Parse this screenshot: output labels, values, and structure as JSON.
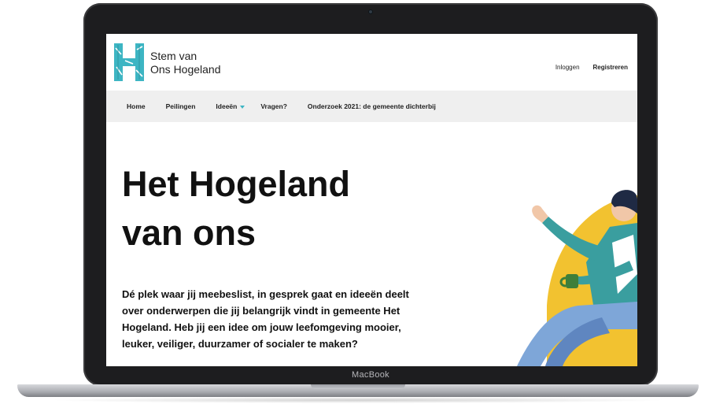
{
  "device": {
    "brand_label": "MacBook"
  },
  "site": {
    "logo": {
      "line1": "Stem van",
      "line2": "Ons Hogeland"
    },
    "auth": {
      "login": "Inloggen",
      "register": "Registreren"
    },
    "nav": [
      {
        "label": "Home"
      },
      {
        "label": "Peilingen"
      },
      {
        "label": "Ideeën"
      },
      {
        "label": "Vragen?"
      },
      {
        "label": "Onderzoek 2021: de gemeente dichterbij"
      }
    ],
    "hero": {
      "title_line1": "Het Hogeland",
      "title_line2": "van ons",
      "intro": "Dé plek waar jij meebeslist, in gesprek gaat en ideeën deelt over onderwerpen die jij belangrijk vindt in gemeente Het Hogeland. Heb jij een idee om jouw leefomgeving mooier, leuker, veiliger, duurzamer of socialer te maken?"
    }
  },
  "colors": {
    "brand_teal": "#3db5c3",
    "nav_bg": "#efefef",
    "accent_yellow": "#f2c230",
    "shirt_teal": "#3a9e9f",
    "pants_blue": "#7ea6d8"
  },
  "icons": {
    "nav_dropdown": "chevron-down-icon",
    "logo": "hogeland-h-logo"
  }
}
